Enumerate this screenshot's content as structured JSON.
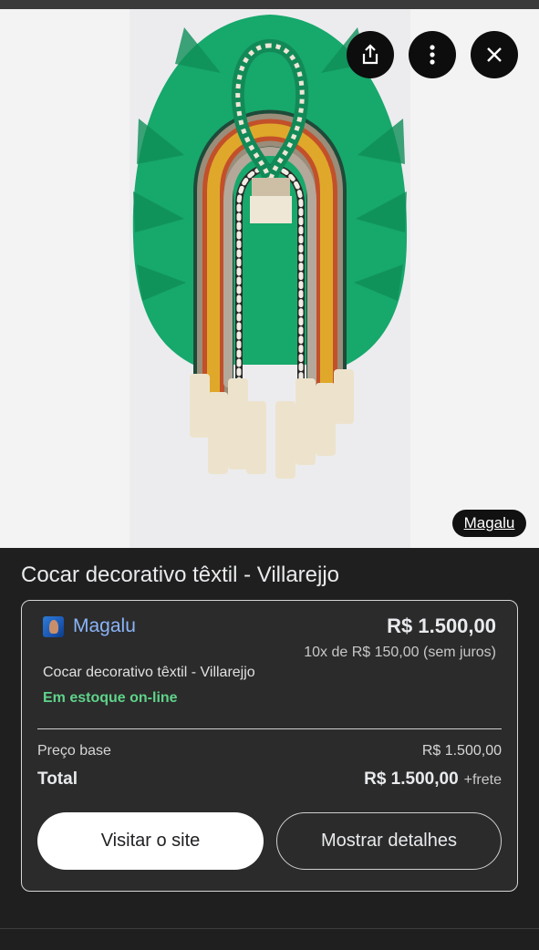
{
  "image_viewer": {
    "source_chip": "Magalu",
    "share_icon": "share-icon",
    "more_icon": "more-vert-icon",
    "close_icon": "close-icon"
  },
  "product": {
    "title": "Cocar decorativo têxtil - Villarejjo"
  },
  "offer": {
    "seller": "Magalu",
    "seller_icon": "magalu-favicon",
    "price": "R$ 1.500,00",
    "installments": "10x de R$ 150,00 (sem juros)",
    "product_name": "Cocar decorativo têxtil - Villarejjo",
    "stock": "Em estoque on-line",
    "base_price_label": "Preço base",
    "base_price_value": "R$ 1.500,00",
    "total_label": "Total",
    "total_value": "R$ 1.500,00",
    "total_extra": "+frete",
    "visit_button": "Visitar o site",
    "details_button": "Mostrar detalhes"
  },
  "colors": {
    "background": "#1f1f1f",
    "link": "#8ab4f8",
    "in_stock": "#5fd38a",
    "feathers": "#16a86a"
  }
}
